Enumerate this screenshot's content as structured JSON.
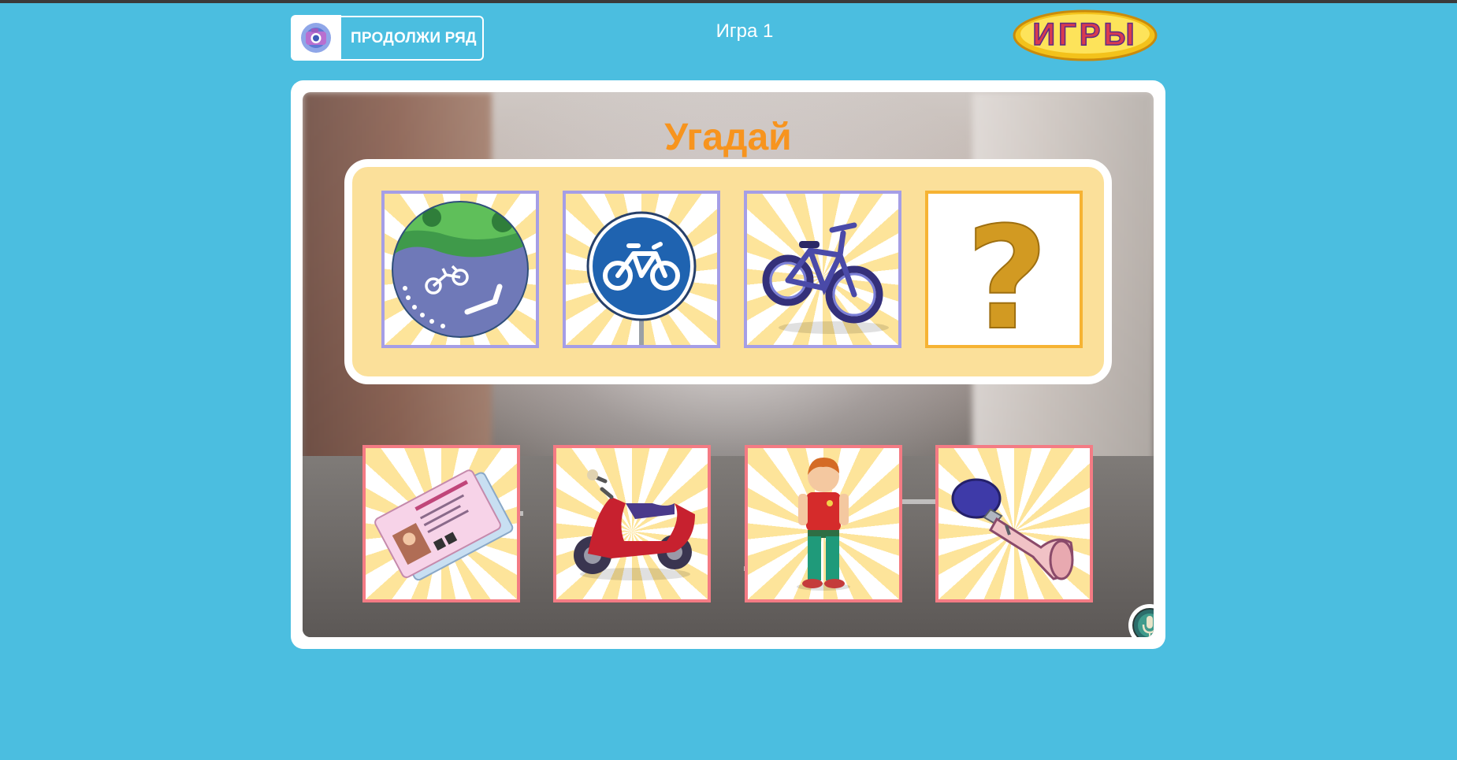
{
  "header": {
    "game_button_label": "ПРОДОЛЖИ РЯД",
    "game_title": "Игра 1",
    "logo_text": "ИГРЫ"
  },
  "board": {
    "title": "Угадай",
    "sequence": [
      {
        "name": "bike-lane-road",
        "kind": "image"
      },
      {
        "name": "bicycle-road-sign",
        "kind": "image"
      },
      {
        "name": "bicycle",
        "kind": "image"
      },
      {
        "name": "question-mark",
        "kind": "unknown"
      }
    ],
    "options": [
      {
        "name": "driver-license"
      },
      {
        "name": "scooter"
      },
      {
        "name": "boy"
      },
      {
        "name": "bicycle-horn"
      }
    ]
  },
  "colors": {
    "background": "#4bbee0",
    "title": "#f7941e",
    "panel": "#fbe09a",
    "sequence_border": "#a59ee6",
    "option_border": "#f47b84",
    "question_border": "#f6b333"
  }
}
